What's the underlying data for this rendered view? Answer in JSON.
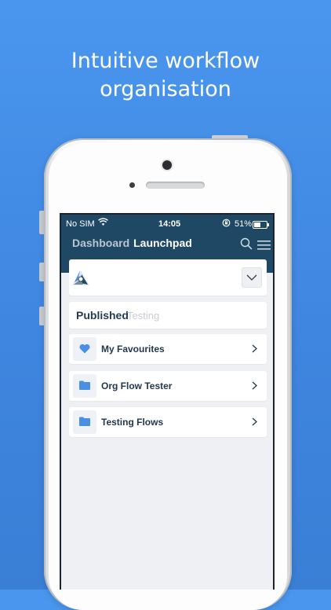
{
  "headline": {
    "line1": "Intuitive workflow",
    "line2": "organisation"
  },
  "status_bar": {
    "carrier": "No SIM",
    "time": "14:05",
    "battery": "51%",
    "battery_level": 0.51
  },
  "nav": {
    "dashboard_label": "Dashboard",
    "launchpad_label": "Launchpad"
  },
  "tabs": {
    "published": "Published",
    "testing": "Testing"
  },
  "list": [
    {
      "label": "My Favourites",
      "icon": "heart-icon"
    },
    {
      "label": "Org Flow Tester",
      "icon": "folder-icon"
    },
    {
      "label": "Testing Flows",
      "icon": "folder-icon"
    }
  ],
  "colors": {
    "background": "#4a96ee",
    "appbar": "#1f4864",
    "accent_icon": "#4a90e2",
    "text_dark": "#22384d"
  }
}
